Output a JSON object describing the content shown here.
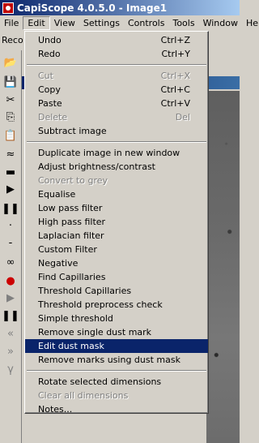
{
  "window": {
    "title": "CapiScope 4.0.5.0 - Image1"
  },
  "menubar": [
    "File",
    "Edit",
    "View",
    "Settings",
    "Controls",
    "Tools",
    "Window",
    "He"
  ],
  "toolbar": {
    "record_label": "Reco"
  },
  "edit_menu": {
    "groups": [
      [
        {
          "label": "Undo",
          "shortcut": "Ctrl+Z"
        },
        {
          "label": "Redo",
          "shortcut": "Ctrl+Y"
        }
      ],
      [
        {
          "label": "Cut",
          "shortcut": "Ctrl+X",
          "disabled": true
        },
        {
          "label": "Copy",
          "shortcut": "Ctrl+C"
        },
        {
          "label": "Paste",
          "shortcut": "Ctrl+V"
        },
        {
          "label": "Delete",
          "shortcut": "Del",
          "disabled": true
        },
        {
          "label": "Subtract image"
        }
      ],
      [
        {
          "label": "Duplicate image in new window"
        },
        {
          "label": "Adjust brightness/contrast"
        },
        {
          "label": "Convert to grey",
          "disabled": true
        },
        {
          "label": "Equalise"
        },
        {
          "label": "Low pass filter"
        },
        {
          "label": "High pass filter"
        },
        {
          "label": "Laplacian filter"
        },
        {
          "label": "Custom Filter"
        },
        {
          "label": "Negative"
        },
        {
          "label": "Find Capillaries"
        },
        {
          "label": "Threshold Capillaries"
        },
        {
          "label": "Threshold preprocess check"
        },
        {
          "label": "Simple threshold"
        },
        {
          "label": "Remove single dust mark"
        },
        {
          "label": "Edit dust mask",
          "selected": true
        },
        {
          "label": "Remove marks using dust mask"
        }
      ],
      [
        {
          "label": "Rotate selected dimensions"
        },
        {
          "label": "Clear all dimensions",
          "disabled": true
        },
        {
          "label": "Notes..."
        }
      ]
    ]
  },
  "left_toolbar": [
    {
      "icon": "open-folder-icon",
      "glyph": "📂"
    },
    {
      "icon": "save-icon",
      "glyph": "💾"
    },
    {
      "icon": "cut-icon",
      "glyph": "✂"
    },
    {
      "icon": "copy-icon",
      "glyph": "⎘"
    },
    {
      "icon": "paste-icon",
      "glyph": "📋"
    },
    {
      "icon": "wave-icon",
      "glyph": "≈"
    },
    {
      "icon": "stop-icon",
      "glyph": "▬"
    },
    {
      "icon": "play-icon",
      "glyph": "▶"
    },
    {
      "icon": "pause-icon",
      "glyph": "❚❚"
    },
    {
      "icon": "small-dot-icon",
      "glyph": "·"
    },
    {
      "icon": "small-dash-icon",
      "glyph": "-"
    },
    {
      "icon": "glasses-icon",
      "glyph": "∞"
    },
    {
      "icon": "record-icon",
      "glyph": "●",
      "color": "#cc0000"
    },
    {
      "icon": "play-grey-icon",
      "glyph": "▶",
      "color": "#808080"
    },
    {
      "icon": "pause-small-icon",
      "glyph": "❚❚"
    },
    {
      "icon": "rewind-icon",
      "glyph": "«",
      "color": "#808080"
    },
    {
      "icon": "fast-forward-icon",
      "glyph": "»",
      "color": "#808080"
    },
    {
      "icon": "gamma-icon",
      "glyph": "γ",
      "color": "#808080"
    }
  ]
}
